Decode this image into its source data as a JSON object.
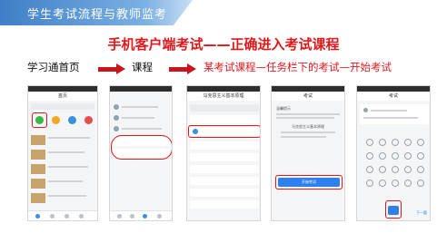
{
  "slide": {
    "banner": "学生考试流程与教师监考",
    "title": "手机客户端考试——正确进入考试课程"
  },
  "steps": {
    "step1": "学习通首页",
    "step2": "课程",
    "step3": "某考试课程—任务栏下的考试—开始考试"
  },
  "phones": {
    "p1": {
      "title": "首页"
    },
    "p3": {
      "title": "马克思主义基本原理"
    },
    "p4": {
      "title": "考试",
      "warning": "温馨提示",
      "exam_title": "马克思主义基本原理",
      "start_button": "开始考试"
    },
    "p5": {
      "title": "考试",
      "footer": "下一题"
    }
  },
  "colors": {
    "accent_red": "#e0181c",
    "brand_blue": "#3f7fc7"
  }
}
